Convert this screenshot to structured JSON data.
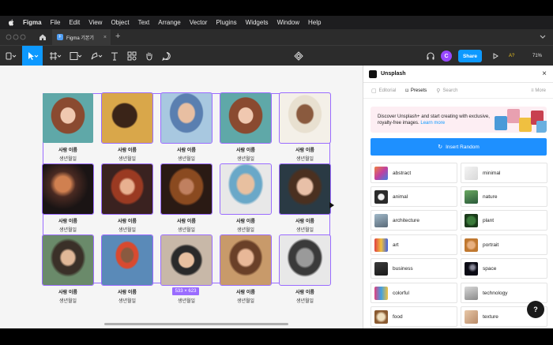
{
  "menubar": {
    "apple_icon": "apple-icon",
    "items": [
      "Figma",
      "File",
      "Edit",
      "View",
      "Object",
      "Text",
      "Arrange",
      "Vector",
      "Plugins",
      "Widgets",
      "Window",
      "Help"
    ]
  },
  "tabbar": {
    "tab_title": "Figma 기본기",
    "new_tab": "+",
    "favicon_letter": "F"
  },
  "toolbar": {
    "share_label": "Share",
    "avatar_letter": "C",
    "ai_label": "A?",
    "zoom_label": "71%",
    "play_icon": "▷"
  },
  "canvas": {
    "cards": [
      {
        "name": "사람 이름",
        "sub": "생년월일"
      },
      {
        "name": "사람 이름",
        "sub": "생년월일"
      },
      {
        "name": "사람 이름",
        "sub": "생년월일"
      },
      {
        "name": "사람 이름",
        "sub": "생년월일"
      },
      {
        "name": "사람 이름",
        "sub": "생년월일"
      },
      {
        "name": "사람 이름",
        "sub": "생년월일"
      },
      {
        "name": "사람 이름",
        "sub": "생년월일"
      },
      {
        "name": "사람 이름",
        "sub": "생년월일"
      },
      {
        "name": "사람 이름",
        "sub": "생년월일"
      },
      {
        "name": "사람 이름",
        "sub": "생년월일"
      },
      {
        "name": "사람 이름",
        "sub": "생년월일"
      },
      {
        "name": "사람 이름",
        "sub": "생년월일"
      },
      {
        "name": "사람 이름",
        "sub": "생년월일"
      },
      {
        "name": "사람 이름",
        "sub": "생년월일"
      },
      {
        "name": "사람 이름",
        "sub": "생년월일"
      }
    ],
    "dimension_badge": "533 × 623"
  },
  "panel": {
    "title": "Unsplash",
    "tabs": {
      "editorial": "Editorial",
      "presets": "Presets",
      "search": "Search",
      "more": "More"
    },
    "banner_text": "Discover Unsplash+ and start creating with exclusive, royalty-free images.",
    "banner_link": "Learn more",
    "insert_random": "Insert Random",
    "tags": [
      "abstract",
      "minimal",
      "animal",
      "nature",
      "architecture",
      "plant",
      "art",
      "portrait",
      "business",
      "space",
      "colorful",
      "technology",
      "food",
      "texture"
    ]
  },
  "help_label": "?",
  "colors": {
    "accent": "#0d99ff",
    "selection": "#9a6cff",
    "avatar": "#9747ff"
  }
}
